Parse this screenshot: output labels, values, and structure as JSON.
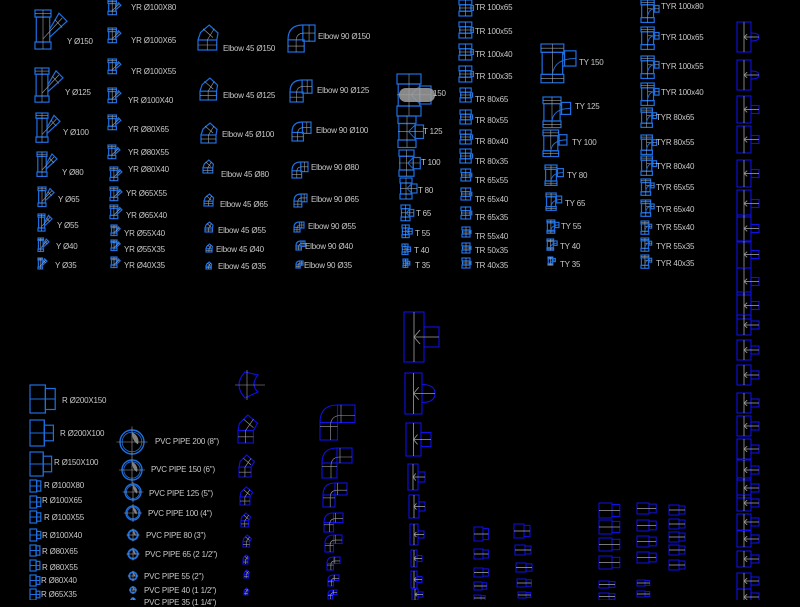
{
  "drawing": {
    "background": "#000000",
    "colors": {
      "symbol_primary": "#1e6fe0",
      "symbol_dark": "#1010e6",
      "centerline": "#a0a0a0",
      "label": "#c8c8c8",
      "hatch": "#808080"
    },
    "groups": {
      "y_fittings": {
        "type": "y",
        "labels": [
          "Y Ø150",
          "Y Ø125",
          "Y Ø100",
          "Y Ø80",
          "Y Ø65",
          "Y Ø55",
          "Y Ø40",
          "Y Ø35"
        ]
      },
      "yr_fittings": {
        "type": "yr",
        "labels": [
          "YR Ø100X80",
          "YR Ø100X65",
          "YR Ø100X55",
          "YR Ø100X40",
          "YR Ø80X65",
          "YR Ø80X55",
          "YR Ø80X40",
          "YR Ø65X55",
          "YR Ø65X40",
          "YR Ø55X40",
          "YR Ø55X35",
          "YR Ø40X35"
        ]
      },
      "elbow45": {
        "type": "elbow45",
        "labels": [
          "Elbow 45 Ø150",
          "Elbow 45 Ø125",
          "Elbow 45 Ø100",
          "Elbow 45 Ø80",
          "Elbow 45 Ø65",
          "Elbow 45 Ø55",
          "Elbow 45 Ø40",
          "Elbow 45 Ø35"
        ]
      },
      "elbow90": {
        "type": "elbow90",
        "labels": [
          "Elbow 90 Ø150",
          "Elbow 90 Ø125",
          "Elbow 90 Ø100",
          "Elbow 90 Ø80",
          "Elbow 90 Ø65",
          "Elbow 90 Ø55",
          "Elbow 90 Ø40",
          "Elbow 90 Ø35"
        ]
      },
      "tees": {
        "type": "tee",
        "labels": [
          "150",
          "T 125",
          "T 100",
          "T 80",
          "T 65",
          "T 55",
          "T 40",
          "T 35"
        ]
      },
      "tr_fittings": {
        "type": "tr",
        "labels": [
          "TR 100x65",
          "TR 100x55",
          "TR 100x40",
          "TR 100x35",
          "TR 80x65",
          "TR 80x55",
          "TR 80x40",
          "TR 80x35",
          "TR 65x55",
          "TR 65x40",
          "TR 65x35",
          "TR 55x40",
          "TR 50x35",
          "TR 40x35"
        ]
      },
      "ty_fittings": {
        "type": "ty",
        "labels": [
          "TY 150",
          "TY 125",
          "TY 100",
          "TY 80",
          "TY 65",
          "TY 55",
          "TY 40",
          "TY 35"
        ]
      },
      "tyr_fittings": {
        "type": "tyr",
        "labels": [
          "TYR 100x80",
          "TYR 100x65",
          "TYR 100x55",
          "TYR 100x40",
          "TYR 80x65",
          "TYR 80x55",
          "TYR 80x40",
          "TYR 65x55",
          "TYR 65x40",
          "TYR 55x40",
          "TYR 55x35",
          "TYR 40x35"
        ]
      },
      "reducers": {
        "type": "reducer",
        "labels": [
          "R Ø200X150",
          "R Ø200X100",
          "R Ø150X100",
          "R Ø100X80",
          "R Ø100X65",
          "R Ø100X55",
          "R Ø100X40",
          "R Ø80X65",
          "R Ø80X55",
          "R Ø80X40",
          "R Ø65X35"
        ]
      },
      "pvc_pipes": {
        "type": "pipe",
        "labels": [
          "PVC PIPE 200 (8\")",
          "PVC PIPE 150 (6\")",
          "PVC PIPE 125 (5\")",
          "PVC PIPE 100 (4\")",
          "PVC PIPE 80 (3\")",
          "PVC PIPE 65 (2 1/2\")",
          "PVC PIPE 55 (2\")",
          "PVC PIPE 40 (1 1/2\")",
          "PVC PIPE 35 (1 1/4\")"
        ]
      }
    }
  }
}
